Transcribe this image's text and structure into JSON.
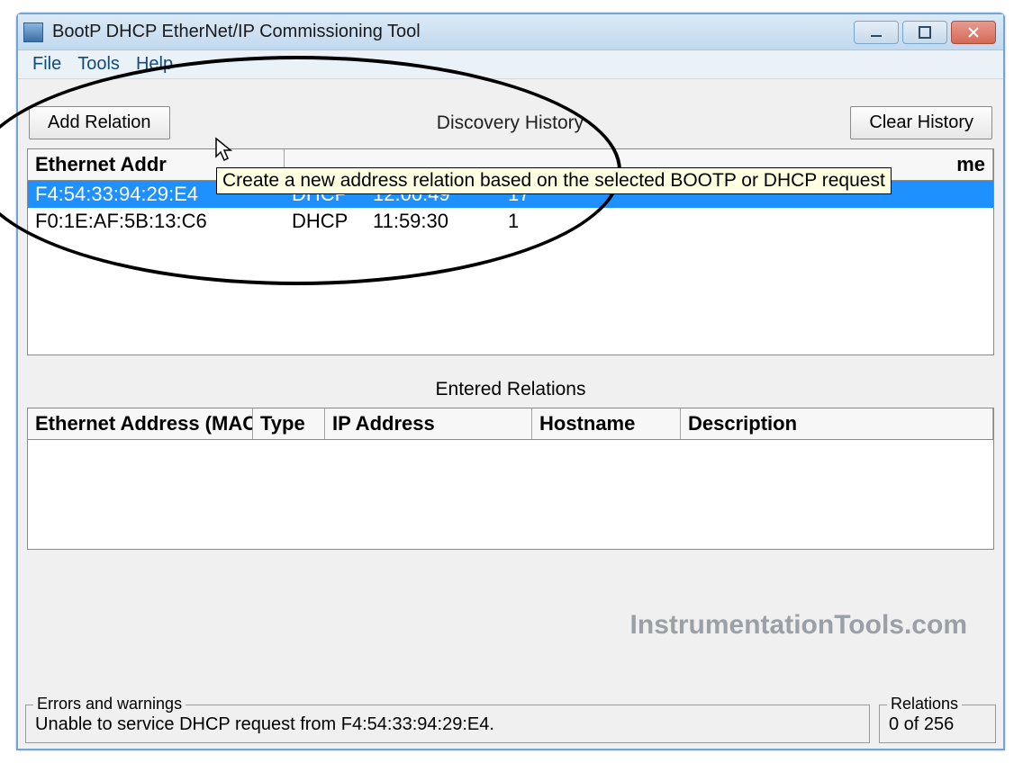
{
  "window": {
    "title": "BootP DHCP EtherNet/IP Commissioning Tool"
  },
  "menu": {
    "file": "File",
    "tools": "Tools",
    "help": "Help"
  },
  "toolbar": {
    "add_relation": "Add Relation",
    "discovery_history": "Discovery History",
    "clear_history": "Clear History"
  },
  "tooltip": "Create a new address relation based on the selected BOOTP or DHCP request",
  "discovery": {
    "columns": {
      "mac": "Ethernet Addr",
      "hostname_suffix": "me"
    },
    "rows": [
      {
        "mac": "F4:54:33:94:29:E4",
        "type": "DHCP",
        "time": "12:00:49",
        "count": "17",
        "selected": true
      },
      {
        "mac": "F0:1E:AF:5B:13:C6",
        "type": "DHCP",
        "time": "11:59:30",
        "count": "1",
        "selected": false
      }
    ]
  },
  "relations": {
    "title": "Entered Relations",
    "columns": {
      "mac": "Ethernet Address (MAC)",
      "type": "Type",
      "ip": "IP Address",
      "hostname": "Hostname",
      "description": "Description"
    }
  },
  "status": {
    "errors_legend": "Errors and warnings",
    "errors_body": "Unable to service DHCP request from F4:54:33:94:29:E4.",
    "relations_legend": "Relations",
    "relations_body": "0 of 256"
  },
  "watermark": "InstrumentationTools.com"
}
